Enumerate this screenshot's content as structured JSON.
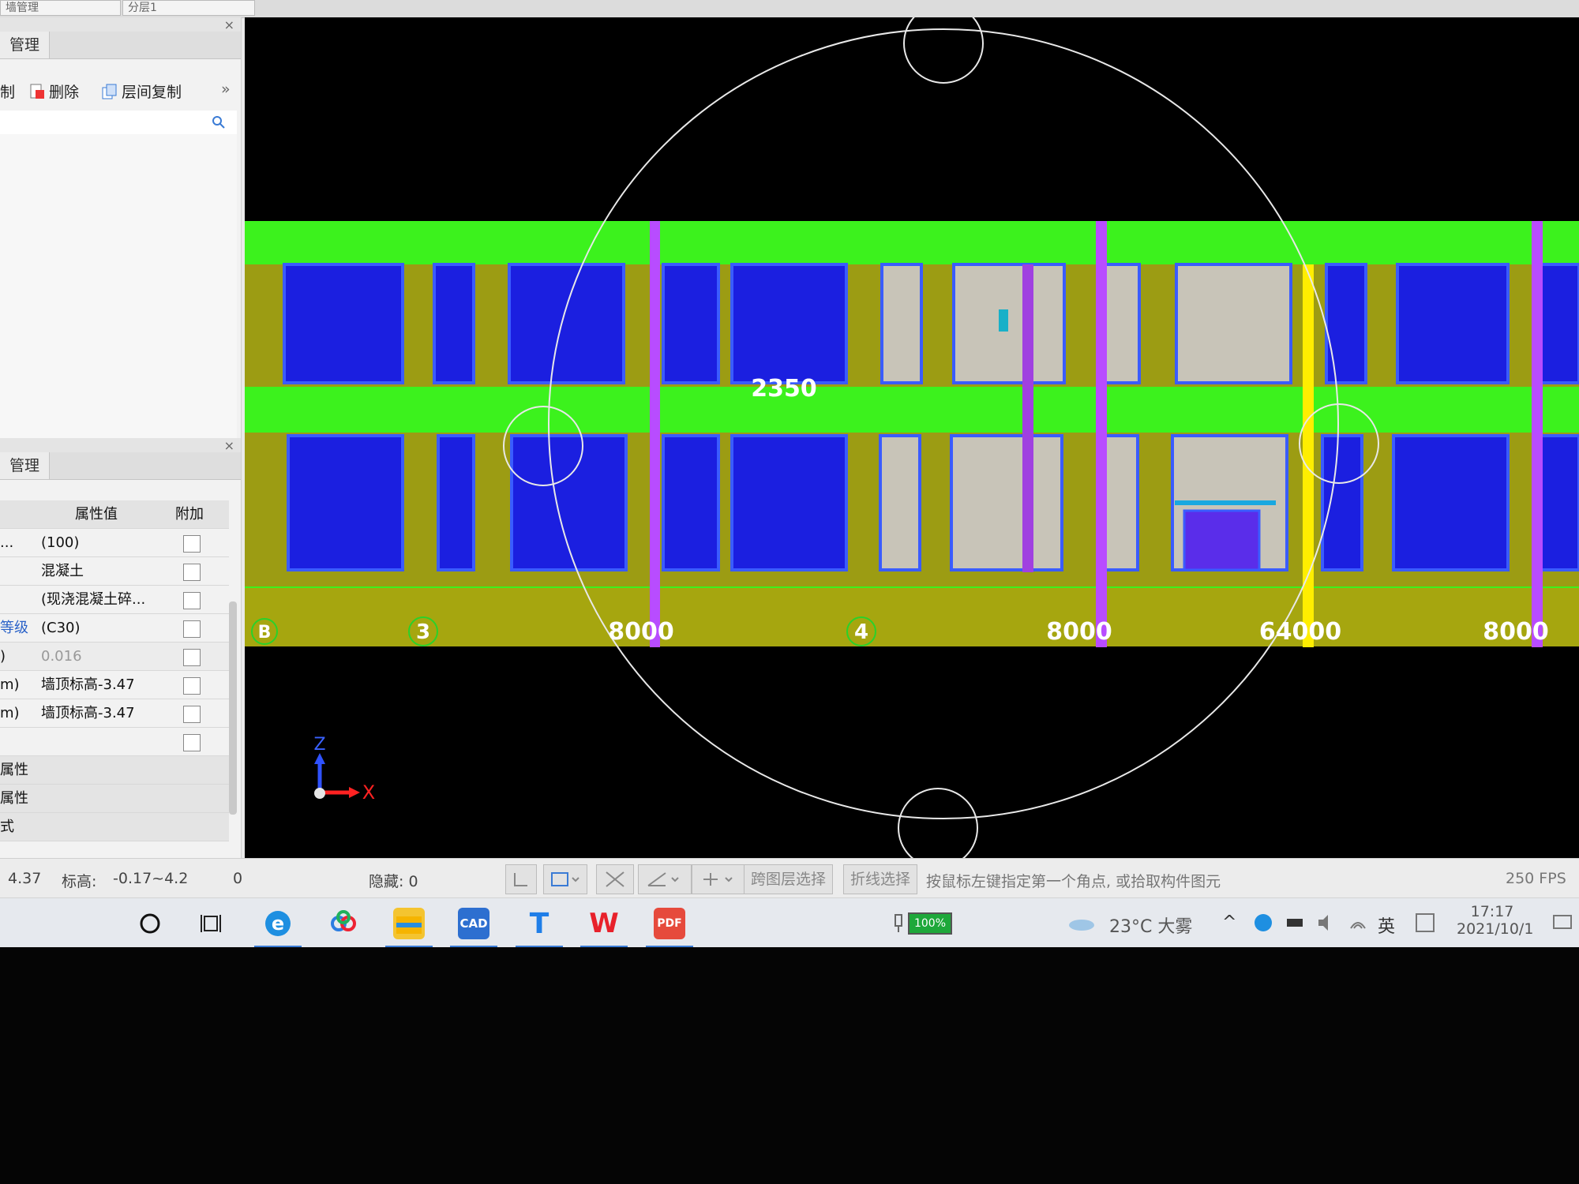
{
  "top": {
    "combo1": "墙管理",
    "combo2": "分层1"
  },
  "layer_panel": {
    "tab": "管理",
    "toolbar": {
      "copy_label": "制",
      "delete_label": "删除",
      "layer_copy_label": "层间复制"
    }
  },
  "props_panel": {
    "tab": "管理",
    "header": {
      "value": "属性值",
      "extra": "附加"
    },
    "rows": [
      {
        "name": "...",
        "value": "(100)"
      },
      {
        "name": "",
        "value": "混凝土"
      },
      {
        "name": "",
        "value": "(现浇混凝土碎..."
      },
      {
        "name": "等级",
        "value": "(C30)"
      },
      {
        "name": ")",
        "value": "0.016"
      },
      {
        "name": "m)",
        "value": "墙顶标高-3.47"
      },
      {
        "name": "m)",
        "value": "墙顶标高-3.47"
      },
      {
        "name": "",
        "value": ""
      },
      {
        "name": "属性",
        "value": ""
      },
      {
        "name": "属性",
        "value": ""
      },
      {
        "name": "式",
        "value": ""
      }
    ]
  },
  "viewport": {
    "label_2350": "2350",
    "axis_z": "Z",
    "axis_x": "X",
    "grid_labels": {
      "a": "B",
      "b": "3",
      "c": "4"
    },
    "dims": {
      "d1": "8000",
      "d2": "8000",
      "d3": "64000",
      "d4": "8000"
    }
  },
  "status": {
    "coord": "4.37",
    "elev_label": "标高:",
    "elev_value": "-0.17~4.2",
    "zero": "0",
    "hidden": "隐藏: 0",
    "btn_cross_layer": "跨图层选择",
    "btn_polyline": "折线选择",
    "hint": "按鼠标左键指定第一个角点, 或拾取构件图元",
    "fps": "250 FPS"
  },
  "taskbar": {
    "battery": "100%",
    "weather": "23°C 大雾",
    "ime": "英",
    "time": "17:17",
    "date": "2021/10/1",
    "apps": [
      "search",
      "task-view",
      "edge",
      "baidu-netdisk",
      "file-explorer",
      "cad",
      "text-editor",
      "wps",
      "pdf"
    ]
  },
  "colors": {
    "beam_green": "#3cf21d",
    "wall_olive": "#9c9c13",
    "window_blue": "#1b1fe0",
    "door_grey": "#c8c4b8",
    "purple_column": "#b84cff",
    "yellow_column": "#ffee00",
    "viewport_bg": "#000000"
  }
}
